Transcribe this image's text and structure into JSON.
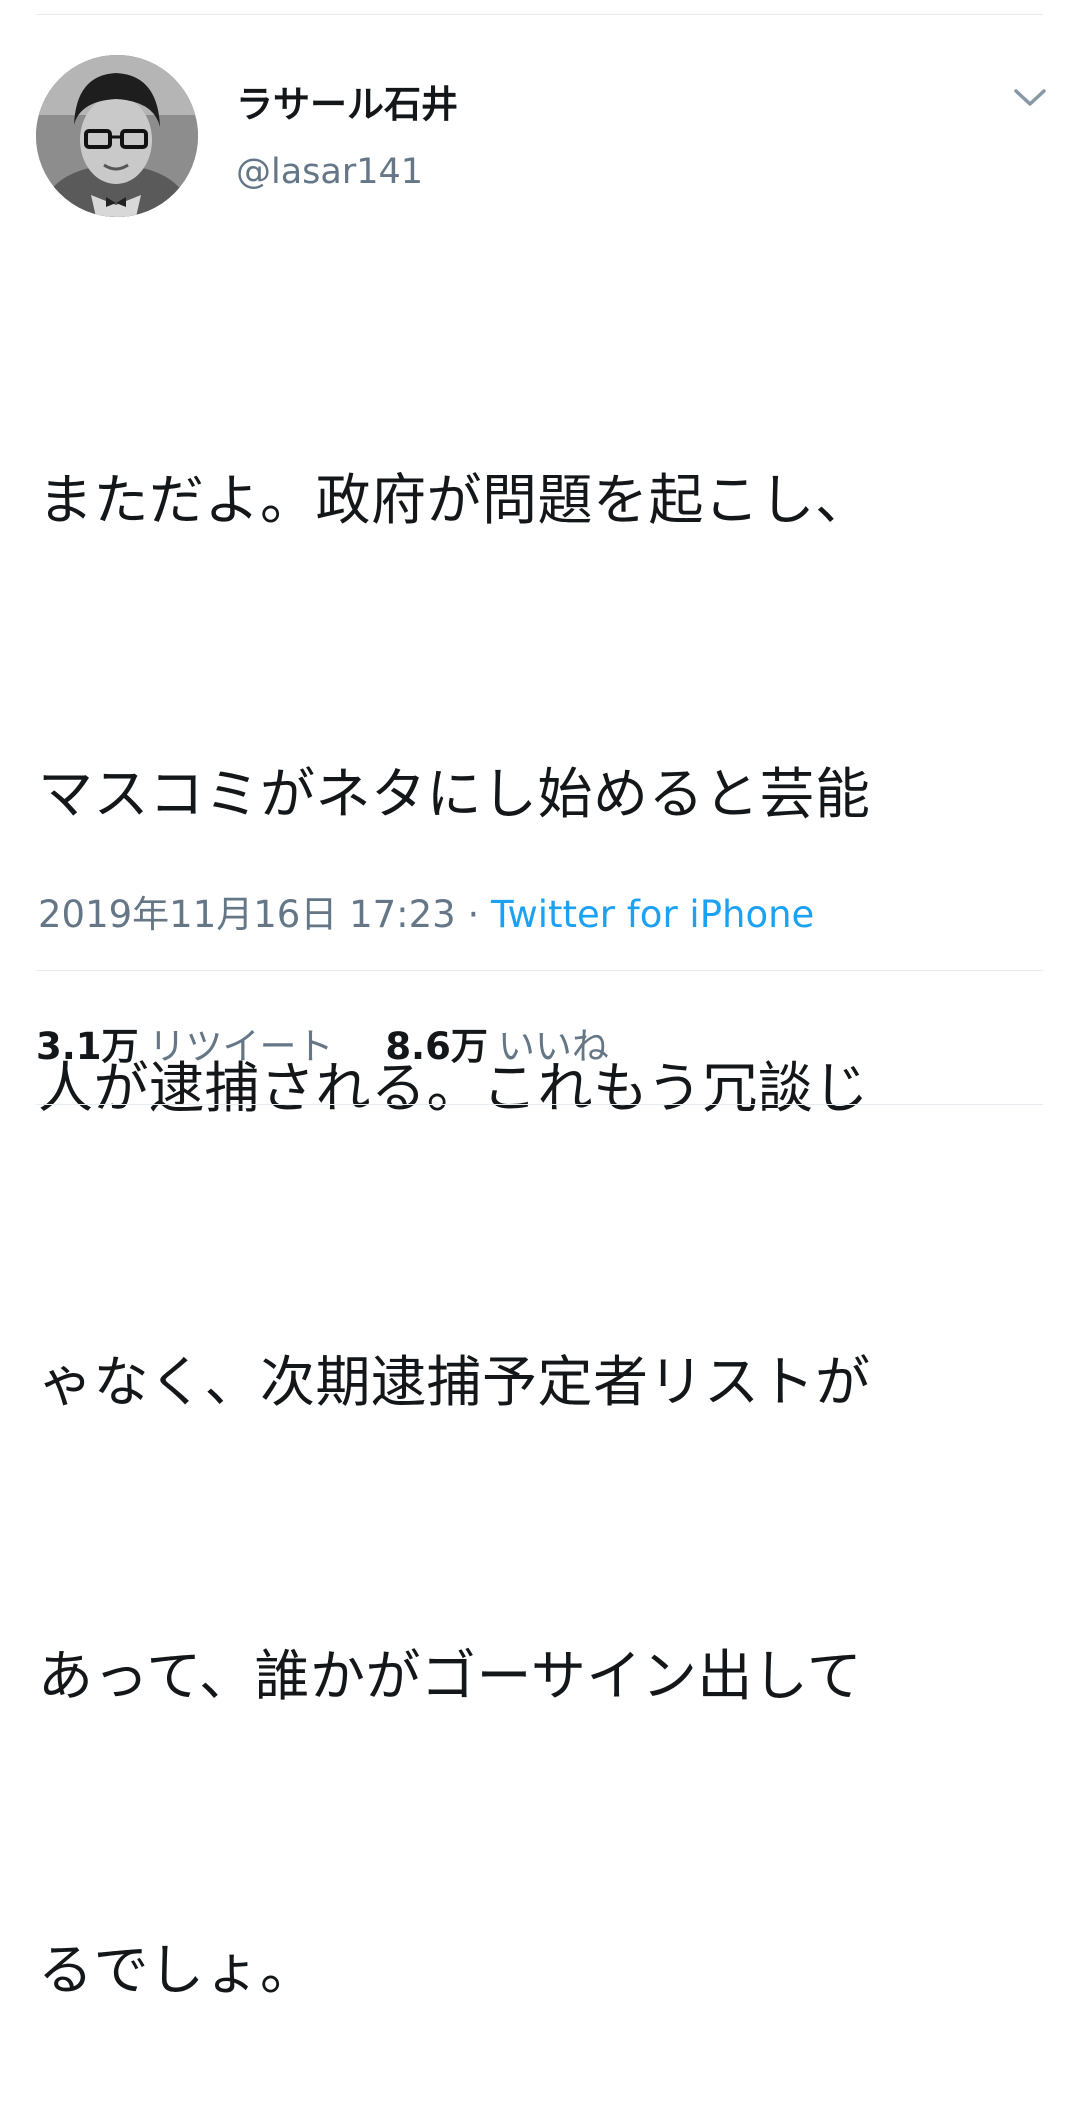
{
  "author": {
    "display_name": "ラサール石井",
    "handle": "@lasar141"
  },
  "tweet": {
    "lines": [
      "まただよ。政府が問題を起こし、",
      "マスコミがネタにし始めると芸能",
      "人が逮捕される。これもう冗談じ",
      "ゃなく、次期逮捕予定者リストが",
      "あって、誰かがゴーサイン出して",
      "るでしょ。"
    ],
    "timestamp": "2019年11月16日 17:23",
    "separator": "·",
    "source": "Twitter for iPhone"
  },
  "stats": {
    "retweets_count": "3.1万",
    "retweets_label": "リツイート",
    "likes_count": "8.6万",
    "likes_label": "いいね"
  },
  "icons": {
    "menu": "chevron-down-icon",
    "avatar": "avatar"
  },
  "colors": {
    "text": "#14171a",
    "secondary": "#657786",
    "link": "#1da1f2",
    "divider": "#e6ecf0"
  }
}
